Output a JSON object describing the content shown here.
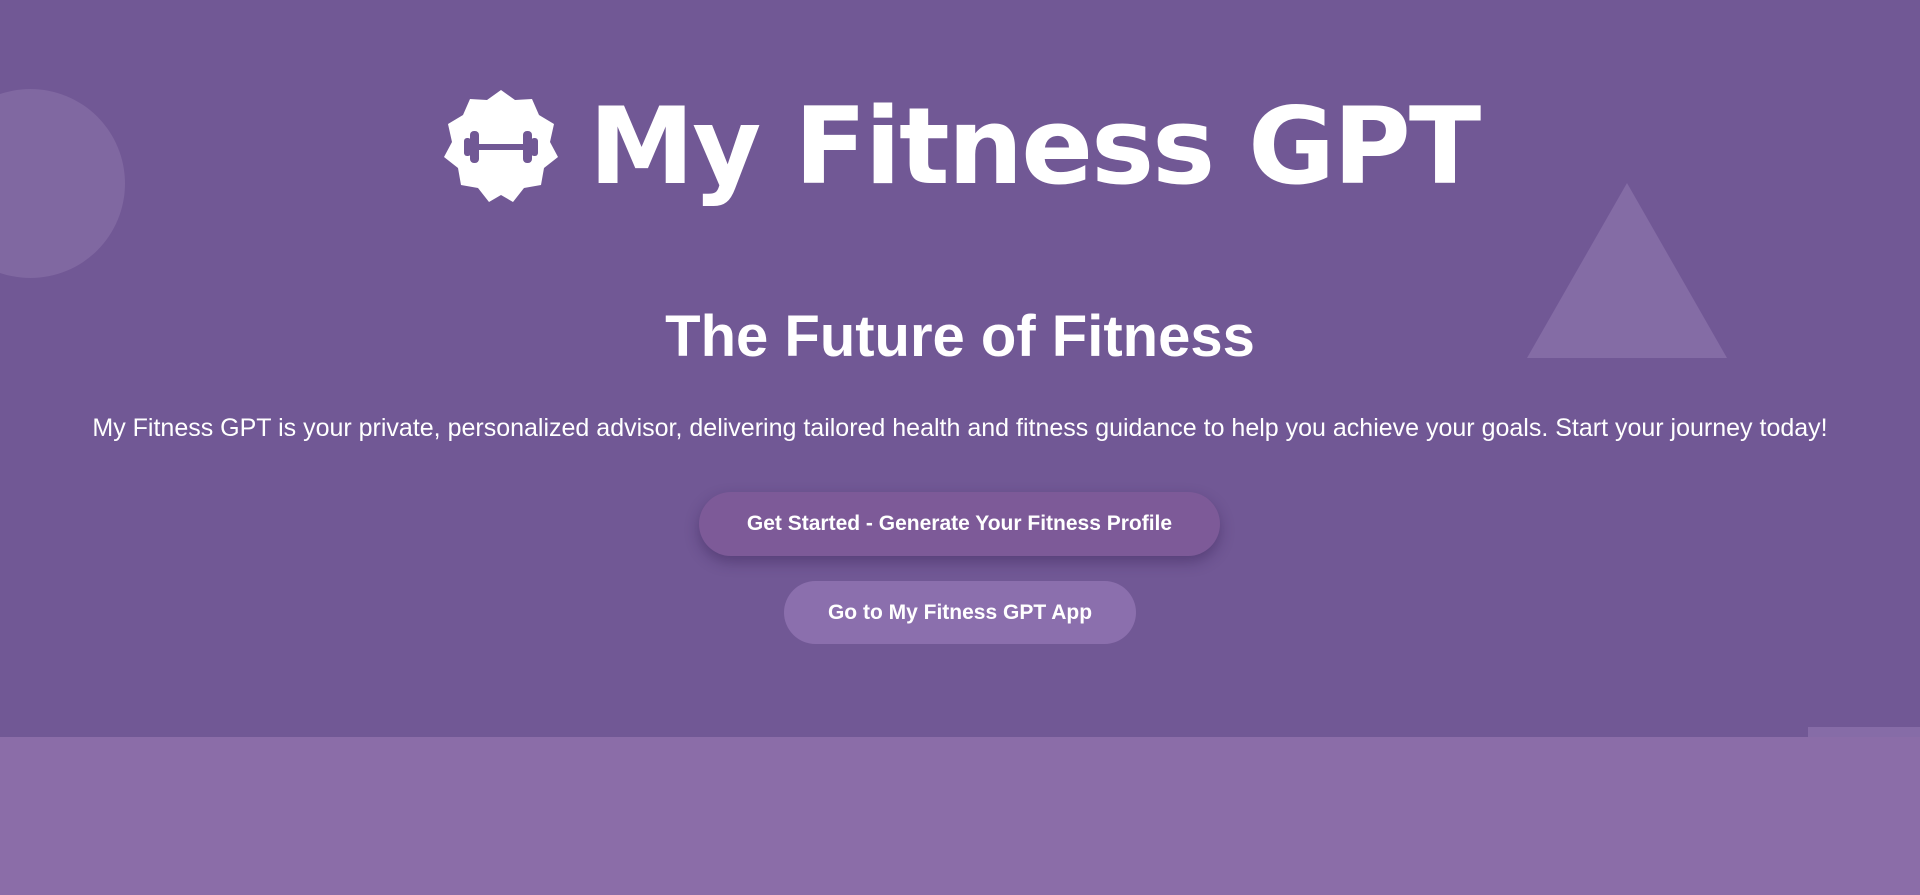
{
  "brand": {
    "name": "My Fitness GPT",
    "icon": "dumbbell-badge-icon"
  },
  "hero": {
    "headline": "The Future of Fitness",
    "tagline": "My Fitness GPT is your private, personalized advisor, delivering tailored health and fitness guidance to help you achieve your goals. Start your journey today!"
  },
  "actions": {
    "primary_label": "Get Started - Generate Your Fitness Profile",
    "secondary_label": "Go to My Fitness GPT App"
  },
  "colors": {
    "hero_background": "#715895",
    "page_background": "#8b6da8",
    "primary_button": "#7d5a98",
    "secondary_button": "#8b6fad",
    "text": "#ffffff"
  }
}
